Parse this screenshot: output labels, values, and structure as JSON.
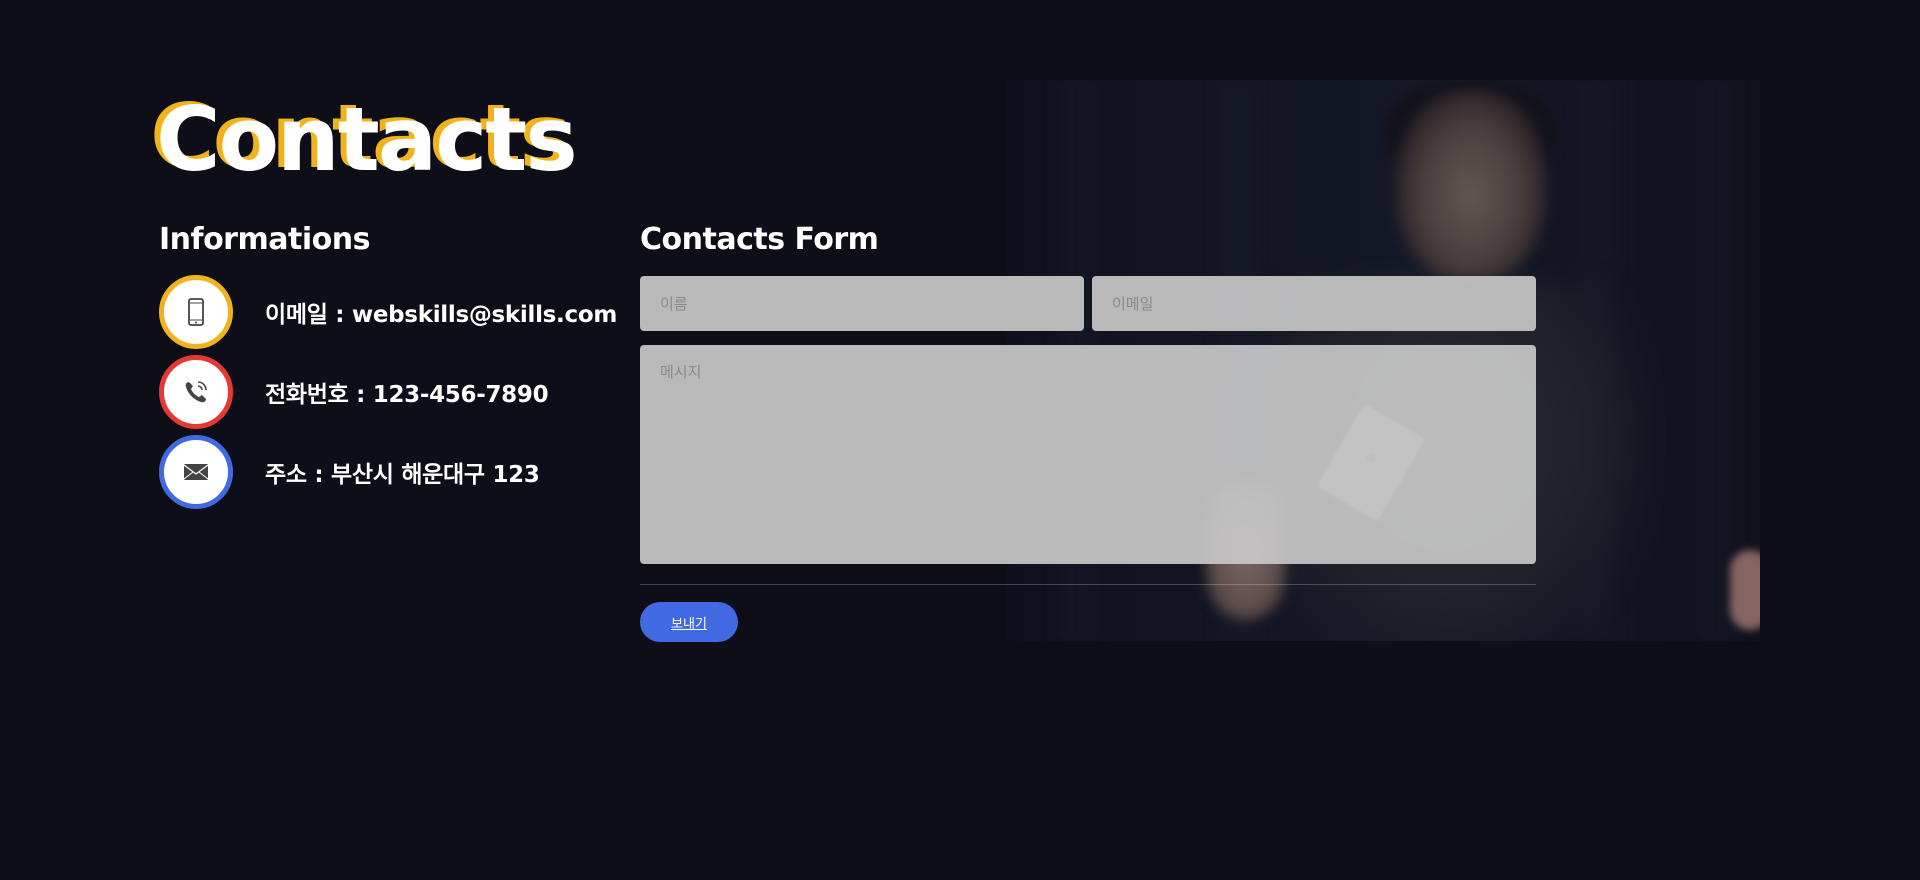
{
  "page": {
    "title": "Contacts"
  },
  "info": {
    "heading": "Informations",
    "items": [
      {
        "icon": "smartphone-icon",
        "text": "이메일 : webskills@skills.com",
        "accent": "#f2b21b"
      },
      {
        "icon": "phone-icon",
        "text": "전화번호 : 123-456-7890",
        "accent": "#e53935"
      },
      {
        "icon": "envelope-icon",
        "text": "주소 : 부산시 해운대구 123",
        "accent": "#4169e1"
      }
    ]
  },
  "form": {
    "heading": "Contacts Form",
    "name_placeholder": "이름",
    "email_placeholder": "이메일",
    "message_placeholder": "메시지",
    "send_label": "보내기"
  },
  "colors": {
    "background": "#0e0e19",
    "title_shadow": "#f2b21b",
    "button": "#4169e1"
  }
}
